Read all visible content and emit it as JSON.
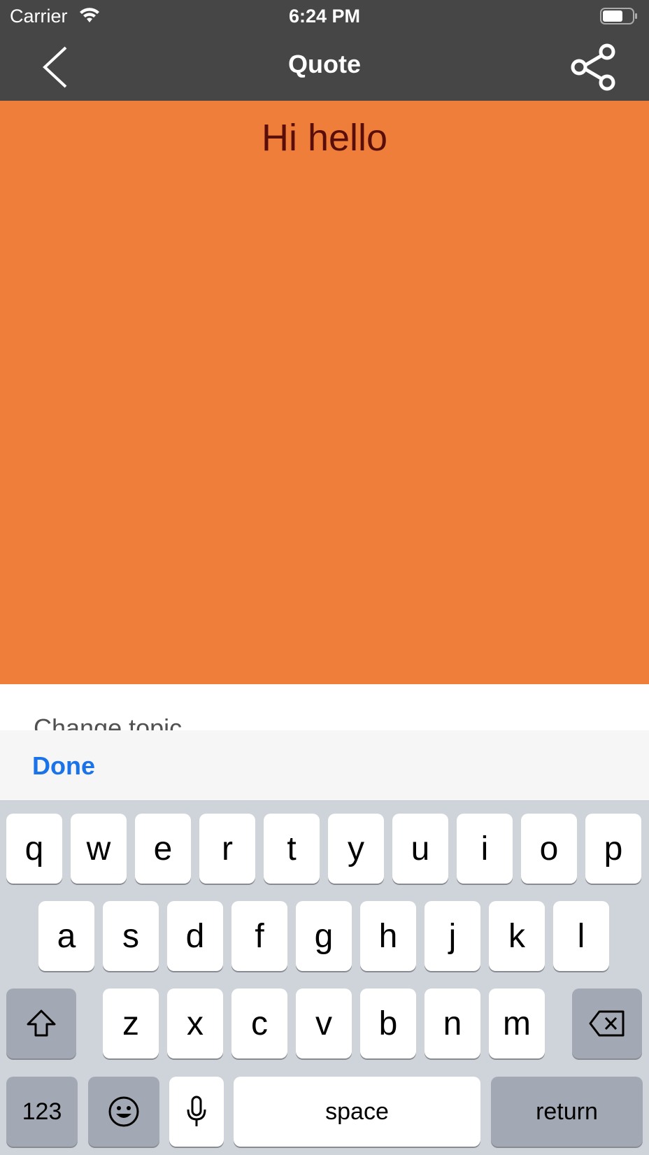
{
  "status_bar": {
    "carrier": "Carrier",
    "time": "6:24 PM"
  },
  "nav": {
    "title": "Quote",
    "back_icon": "chevron-left-icon",
    "share_icon": "share-icon"
  },
  "quote": {
    "text": "Hi hello",
    "background_color": "#ee7e3a",
    "text_color": "#5a0e0a"
  },
  "partially_hidden_label": "Change topic",
  "toolbar": {
    "done_label": "Done"
  },
  "keyboard": {
    "row1": [
      "q",
      "w",
      "e",
      "r",
      "t",
      "y",
      "u",
      "i",
      "o",
      "p"
    ],
    "row2": [
      "a",
      "s",
      "d",
      "f",
      "g",
      "h",
      "j",
      "k",
      "l"
    ],
    "row3": [
      "z",
      "x",
      "c",
      "v",
      "b",
      "n",
      "m"
    ],
    "numbers_label": "123",
    "space_label": "space",
    "return_label": "return"
  }
}
